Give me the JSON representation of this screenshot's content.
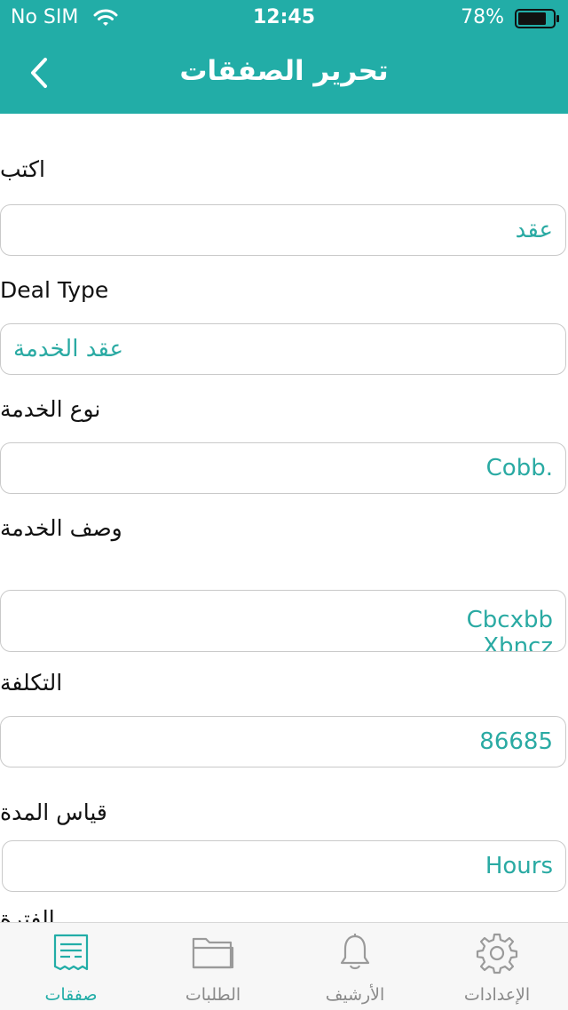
{
  "status_bar": {
    "carrier": "No SIM",
    "time": "12:45",
    "battery": "78%"
  },
  "nav": {
    "title": "تحرير الصفقات"
  },
  "form": {
    "write_label": "اكتب",
    "write_value": "عقد",
    "deal_type_label": "Deal Type",
    "deal_type_value": "عقد الخدمة",
    "service_type_label": "نوع الخدمة",
    "service_type_value": "Cobb.",
    "service_desc_label": "وصف الخدمة",
    "service_desc_value": "Cbcxbb\nXbncz",
    "cost_label": "التكلفة",
    "cost_value": "86685",
    "duration_unit_label": "قياس المدة",
    "duration_unit_value": "Hours",
    "next_label_partial": "الفترة"
  },
  "tabs": [
    {
      "label": "صفقات",
      "icon": "receipt-icon",
      "active": true
    },
    {
      "label": "الطلبات",
      "icon": "folder-icon",
      "active": false
    },
    {
      "label": "الأرشيف",
      "icon": "bell-icon",
      "active": false
    },
    {
      "label": "الإعدادات",
      "icon": "gear-icon",
      "active": false
    }
  ],
  "colors": {
    "accent": "#22ada7",
    "value_text": "#2aaaa3",
    "border": "#c9c9c9",
    "tab_inactive": "#8a8a8a"
  }
}
